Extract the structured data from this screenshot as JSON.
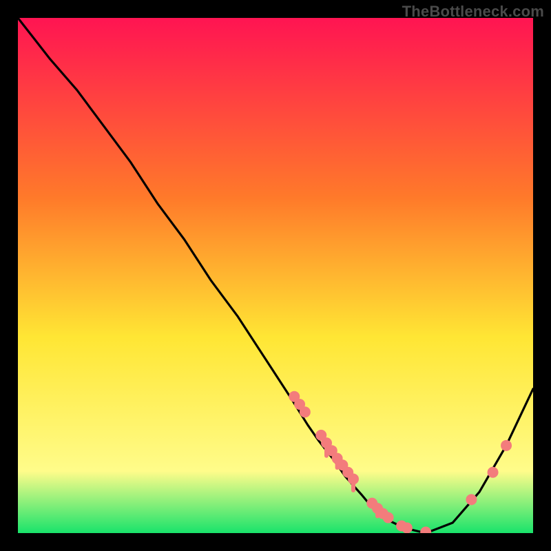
{
  "watermark": "TheBottleneck.com",
  "colors": {
    "gradient_top": "#ff1452",
    "gradient_mid1": "#ff7a2a",
    "gradient_mid2": "#ffe634",
    "gradient_mid3": "#fffc8a",
    "gradient_bottom": "#19e36b",
    "curve": "#000000",
    "marker": "#f37c7c",
    "background": "#000000"
  },
  "chart_data": {
    "type": "line",
    "title": "",
    "xlabel": "",
    "ylabel": "",
    "xlim": [
      0.04,
      1.0
    ],
    "ylim": [
      0.0,
      1.0
    ],
    "grid": false,
    "series": [
      {
        "name": "bottleneck-curve",
        "x": [
          0.04,
          0.07,
          0.1,
          0.15,
          0.2,
          0.25,
          0.3,
          0.35,
          0.4,
          0.45,
          0.5,
          0.55,
          0.58,
          0.6,
          0.63,
          0.65,
          0.68,
          0.7,
          0.73,
          0.76,
          0.8,
          0.85,
          0.9,
          0.95,
          1.0
        ],
        "y": [
          1.0,
          0.96,
          0.92,
          0.86,
          0.79,
          0.72,
          0.64,
          0.57,
          0.49,
          0.42,
          0.34,
          0.26,
          0.21,
          0.18,
          0.14,
          0.11,
          0.075,
          0.05,
          0.025,
          0.01,
          0.0,
          0.02,
          0.08,
          0.17,
          0.28
        ]
      }
    ],
    "markers": [
      {
        "x": 0.555,
        "y": 0.265
      },
      {
        "x": 0.565,
        "y": 0.25
      },
      {
        "x": 0.575,
        "y": 0.235
      },
      {
        "x": 0.605,
        "y": 0.19
      },
      {
        "x": 0.615,
        "y": 0.175
      },
      {
        "x": 0.625,
        "y": 0.16
      },
      {
        "x": 0.635,
        "y": 0.145
      },
      {
        "x": 0.645,
        "y": 0.132
      },
      {
        "x": 0.655,
        "y": 0.118
      },
      {
        "x": 0.665,
        "y": 0.105
      },
      {
        "x": 0.7,
        "y": 0.058
      },
      {
        "x": 0.71,
        "y": 0.048
      },
      {
        "x": 0.72,
        "y": 0.038
      },
      {
        "x": 0.73,
        "y": 0.03
      },
      {
        "x": 0.755,
        "y": 0.014
      },
      {
        "x": 0.765,
        "y": 0.01
      },
      {
        "x": 0.8,
        "y": 0.002
      },
      {
        "x": 0.885,
        "y": 0.065
      },
      {
        "x": 0.925,
        "y": 0.118
      },
      {
        "x": 0.95,
        "y": 0.17
      }
    ],
    "drips": [
      {
        "x": 0.615,
        "y_top": 0.175,
        "len": 0.025
      },
      {
        "x": 0.635,
        "y_top": 0.145,
        "len": 0.018
      },
      {
        "x": 0.665,
        "y_top": 0.105,
        "len": 0.022
      },
      {
        "x": 0.71,
        "y_top": 0.048,
        "len": 0.015
      }
    ]
  }
}
